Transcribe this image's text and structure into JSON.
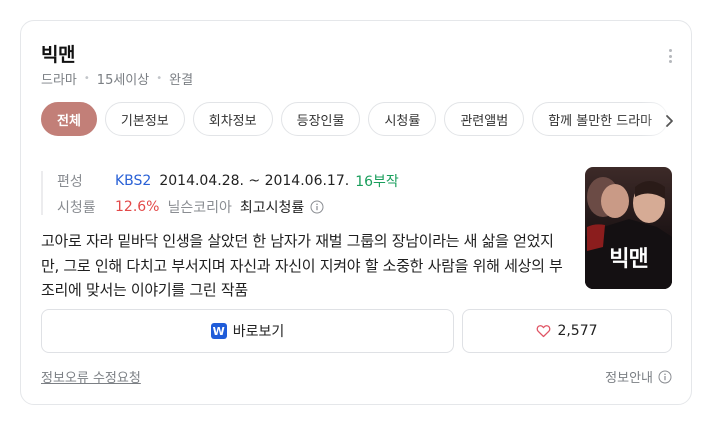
{
  "title": "빅맨",
  "meta": [
    "드라마",
    "15세이상",
    "완결"
  ],
  "tabs": [
    {
      "label": "전체",
      "active": true
    },
    {
      "label": "기본정보",
      "active": false
    },
    {
      "label": "회차정보",
      "active": false
    },
    {
      "label": "등장인물",
      "active": false
    },
    {
      "label": "시청률",
      "active": false
    },
    {
      "label": "관련앨범",
      "active": false
    },
    {
      "label": "함께 볼만한 드라마",
      "active": false
    }
  ],
  "info": {
    "broadcast_label": "편성",
    "network": "KBS2",
    "period": "2014.04.28. ~ 2014.06.17.",
    "episodes": "16부작",
    "rating_label": "시청률",
    "rating_value": "12.6%",
    "rating_source": "닐슨코리아",
    "rating_type": "최고시청률"
  },
  "description": "고아로 자라 밑바닥 인생을 살았던 한 남자가 재벌 그룹의 장남이라는 새 삶을 얻었지만, 그로 인해 다치고 부서지며 자신과 자신이 지켜야 할 소중한 사람을 위해 세상의 부조리에 맞서는 이야기를 그린 작품",
  "poster_text": "빅맨",
  "buttons": {
    "watch_label": "바로보기",
    "watch_logo": "W",
    "like_count": "2,577"
  },
  "footer": {
    "report": "정보오류 수정요청",
    "guide": "정보안내"
  },
  "colors": {
    "active_tab": "#c27f78",
    "network_link": "#2a61d6",
    "episodes": "#1a9e5c",
    "rating": "#e34a4a",
    "watch_logo": "#1f5cd9"
  },
  "icons": {
    "more": "kebab-vertical-icon",
    "tab_next": "chevron-right-icon",
    "info": "info-circle-icon",
    "like": "heart-outline-icon",
    "guide": "info-circle-icon"
  }
}
